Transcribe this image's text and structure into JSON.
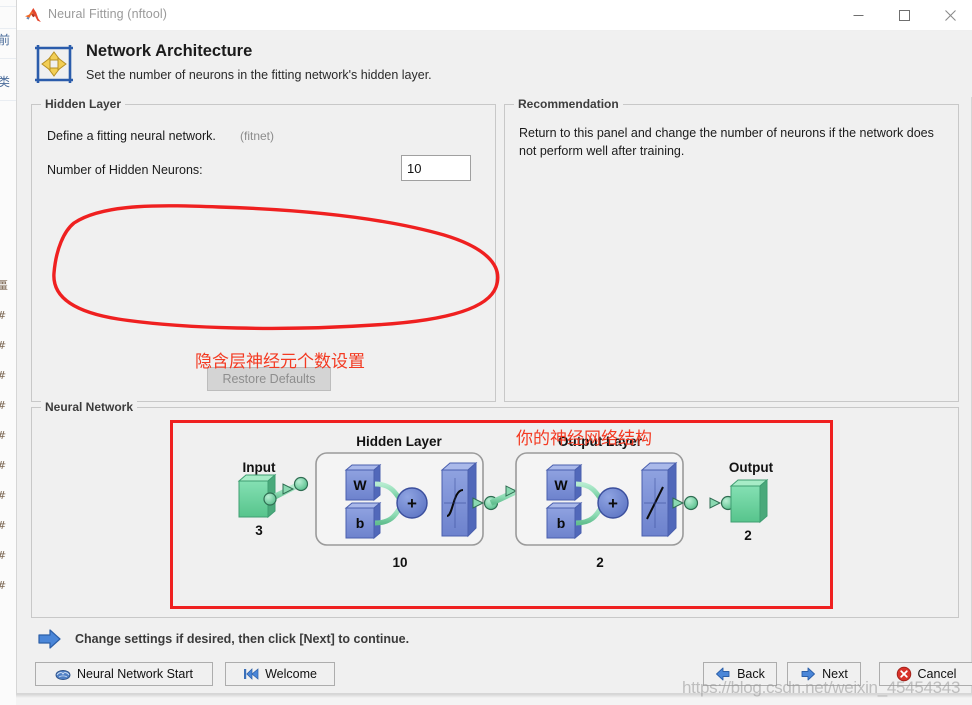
{
  "window": {
    "title": "Neural Fitting (nftool)",
    "app_icon": "matlab-logo-icon",
    "minimize_label": "Minimize",
    "maximize_label": "Maximize",
    "close_label": "Close"
  },
  "header": {
    "icon": "network-architecture-icon",
    "title": "Network Architecture",
    "subtitle": "Set the number of neurons in the fitting network's hidden layer."
  },
  "hidden_layer": {
    "group_title": "Hidden Layer",
    "define_text": "Define a fitting neural network.",
    "fitnet_hint": "(fitnet)",
    "neurons_label": "Number of Hidden Neurons:",
    "neurons_value": "10",
    "restore_defaults_label": "Restore Defaults"
  },
  "recommendation": {
    "group_title": "Recommendation",
    "text": "Return to this panel and change the number of neurons if the network does not perform well after training."
  },
  "neural_network": {
    "group_title": "Neural Network"
  },
  "annotations": {
    "hidden_layer_note": "隐含层神经元个数设置",
    "diagram_note": "你的神经网络结构",
    "highlight_color": "#ef2020",
    "note_color": "#f33a22"
  },
  "diagram": {
    "input_label": "Input",
    "input_size": "3",
    "hidden_layer_label": "Hidden Layer",
    "hidden_layer_size": "10",
    "output_layer_label": "Output Layer",
    "output_layer_size": "2",
    "output_label": "Output",
    "output_size": "2",
    "weight_symbol": "W",
    "bias_symbol": "b",
    "sum_symbol": "+",
    "hidden_transfer": "sigmoid-transfer-icon",
    "output_transfer": "linear-transfer-icon",
    "block_color": "#7b8fd6",
    "io_color": "#73d6a4",
    "link_color": "#8fd8b0"
  },
  "footer": {
    "hint_icon": "blue-arrow-icon",
    "hint_text": "Change settings  if desired, then click [Next] to continue.",
    "buttons": {
      "neural_network_start": "Neural Network Start",
      "welcome": "Welcome",
      "back": "Back",
      "next": "Next",
      "cancel": "Cancel"
    }
  },
  "watermark": {
    "text": "https://blog.csdn.net/weixin_45454343"
  }
}
